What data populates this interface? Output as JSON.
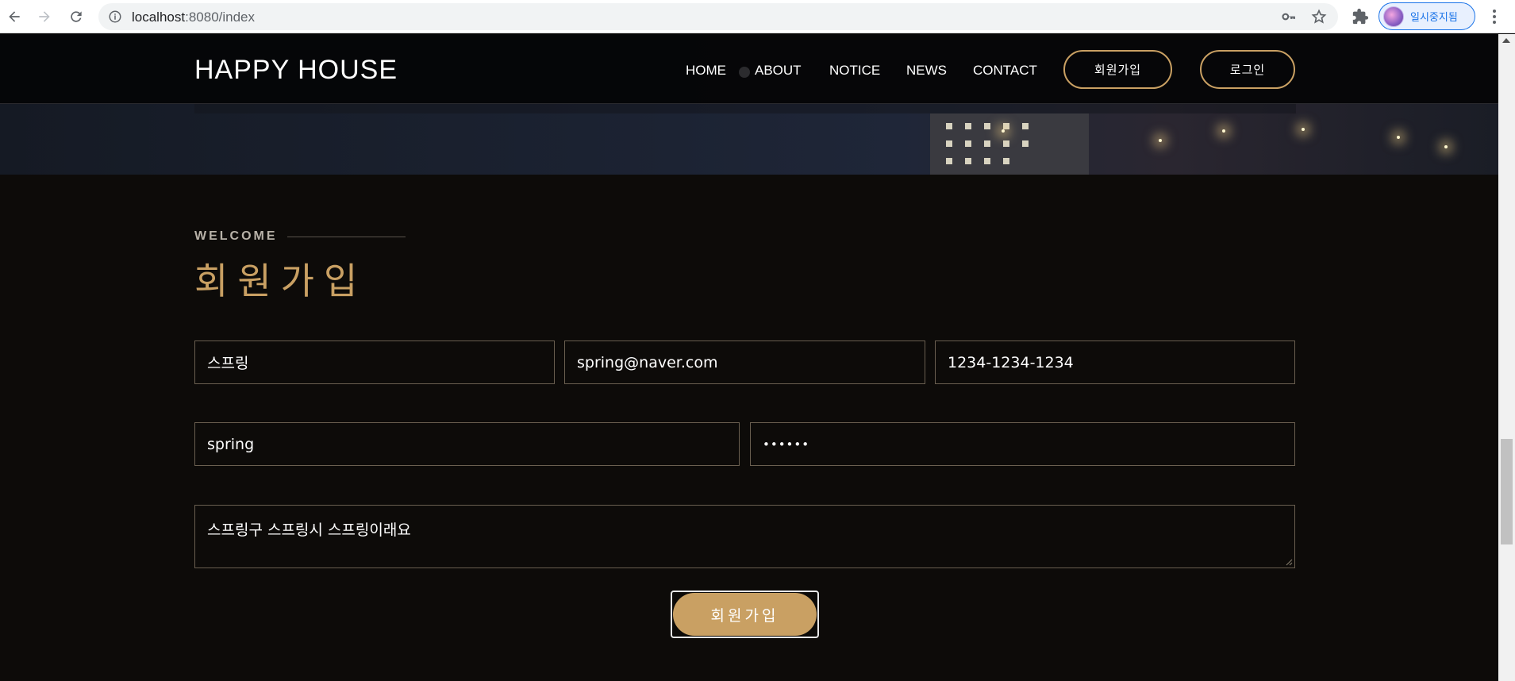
{
  "browser": {
    "url_host": "localhost",
    "url_rest": ":8080/index",
    "profile_name": "일시중지됨",
    "icons": [
      "back-icon",
      "forward-icon",
      "reload-icon",
      "info-icon",
      "key-icon",
      "star-icon",
      "extensions-icon",
      "menu-icon"
    ]
  },
  "header": {
    "logo": "HAPPY HOUSE",
    "nav": [
      "HOME",
      "ABOUT",
      "NOTICE",
      "NEWS",
      "CONTACT"
    ],
    "signup_label": "회원가입",
    "login_label": "로그인"
  },
  "section": {
    "eyebrow": "WELCOME",
    "title": "회원가입"
  },
  "form": {
    "name": "스프링",
    "email": "spring@naver.com",
    "phone": "1234-1234-1234",
    "user_id": "spring",
    "password_mask": "••••••",
    "address": "스프링구 스프링시 스프링이래요",
    "submit_label": "회원가입"
  },
  "colors": {
    "accent": "#c9a063",
    "background": "#0d0b09",
    "border": "#6a5f50"
  }
}
